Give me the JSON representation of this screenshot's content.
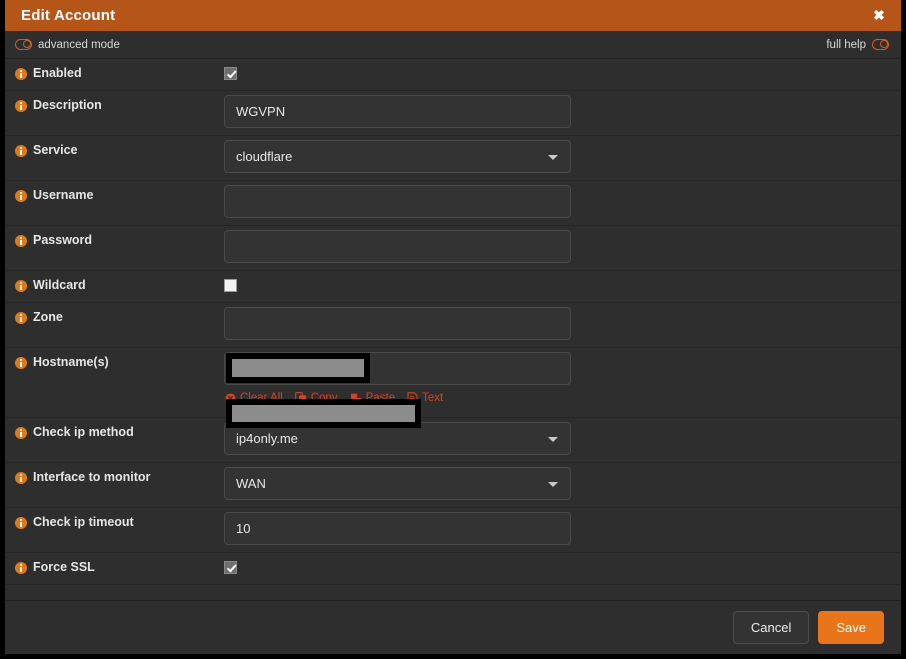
{
  "window": {
    "title": "Edit Account",
    "close_label": "✖"
  },
  "modebar": {
    "advanced_mode_label": "advanced mode",
    "full_help_label": "full help"
  },
  "form": {
    "rows": [
      {
        "label": "Enabled",
        "type": "checkbox",
        "value": "checked"
      },
      {
        "label": "Description",
        "type": "text",
        "value": "WGVPN",
        "placeholder": ""
      },
      {
        "label": "Service",
        "type": "select",
        "value": "cloudflare"
      },
      {
        "label": "Username",
        "type": "text",
        "value": "",
        "placeholder": ""
      },
      {
        "label": "Password",
        "type": "password",
        "value": "",
        "placeholder": ""
      },
      {
        "label": "Wildcard",
        "type": "checkbox",
        "value": "unchecked"
      },
      {
        "label": "Zone",
        "type": "text",
        "value": "",
        "placeholder": "",
        "redacted": true
      },
      {
        "label": "Hostname(s)",
        "type": "text",
        "value": "",
        "placeholder": "",
        "redacted": true
      },
      {
        "label": "Check ip method",
        "type": "select",
        "value": "ip4only.me"
      },
      {
        "label": "Interface to monitor",
        "type": "select",
        "value": "WAN"
      },
      {
        "label": "Check ip timeout",
        "type": "text",
        "value": "10",
        "placeholder": ""
      },
      {
        "label": "Force SSL",
        "type": "checkbox",
        "value": "checked"
      }
    ]
  },
  "hostname_actions": [
    {
      "label": "Clear All",
      "icon": "clear-circle-x-icon"
    },
    {
      "label": "Copy",
      "icon": "copy-icon"
    },
    {
      "label": "Paste",
      "icon": "paste-icon"
    },
    {
      "label": "Text",
      "icon": "text-document-icon"
    }
  ],
  "footer": {
    "cancel_label": "Cancel",
    "save_label": "Save"
  },
  "colors": {
    "titlebar": "#b55618",
    "accent": "#e8751a",
    "link": "#d9411e",
    "info_icon": "#e07a18",
    "background": "#2e2e2e",
    "field_background": "#333333",
    "redaction": "#000000"
  }
}
